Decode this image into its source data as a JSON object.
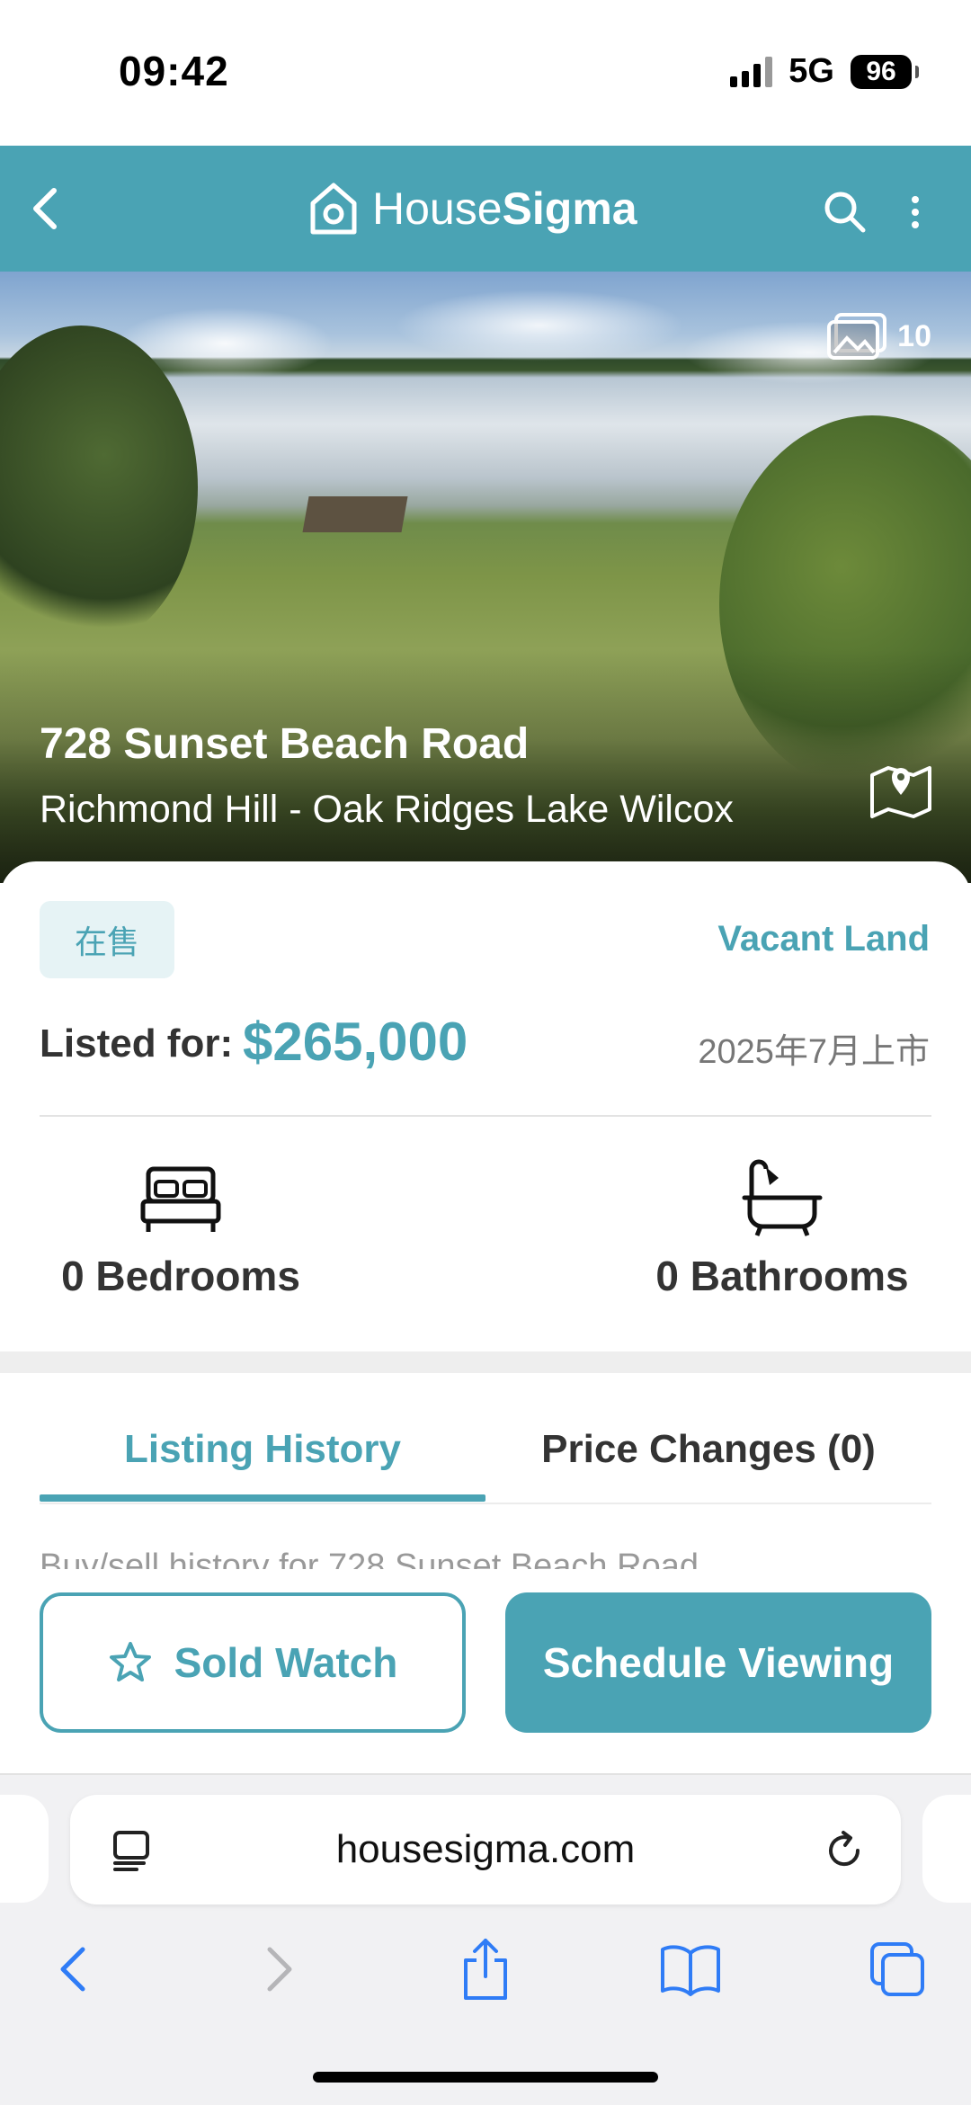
{
  "status_bar": {
    "time": "09:42",
    "network": "5G",
    "battery": "96"
  },
  "header": {
    "logo_text_regular": "House",
    "logo_text_bold": "Sigma"
  },
  "hero": {
    "photo_count": "10",
    "address": "728 Sunset Beach Road",
    "neighborhood": "Richmond Hill - Oak Ridges Lake Wilcox"
  },
  "listing": {
    "status": "在售",
    "property_type": "Vacant Land",
    "price_label": "Listed for:",
    "price": "$265,000",
    "listed_date": "2025年7月上市",
    "bedrooms": "0 Bedrooms",
    "bathrooms": "0 Bathrooms"
  },
  "tabs": {
    "history": "Listing History",
    "price_changes": "Price Changes (0)",
    "active": "history"
  },
  "history_text": "Buy/sell history for 728 Sunset Beach Road,",
  "actions": {
    "watch": "Sold Watch",
    "schedule": "Schedule Viewing"
  },
  "browser": {
    "url": "housesigma.com"
  },
  "colors": {
    "brand": "#4aa3b4",
    "brand_light": "#e6f3f5",
    "ios_blue": "#2f7cf6"
  },
  "icons": {
    "back": "chevron-left-icon",
    "search": "search-icon",
    "more": "more-vertical-icon",
    "photos": "photos-icon",
    "map": "map-pin-icon",
    "bed": "bed-icon",
    "bath": "bathtub-icon",
    "star": "star-icon",
    "reader": "reader-icon",
    "reload": "reload-icon",
    "nav_back": "chevron-left-icon",
    "nav_forward": "chevron-right-icon",
    "share": "share-icon",
    "bookmarks": "book-icon",
    "tabs": "tabs-icon"
  }
}
